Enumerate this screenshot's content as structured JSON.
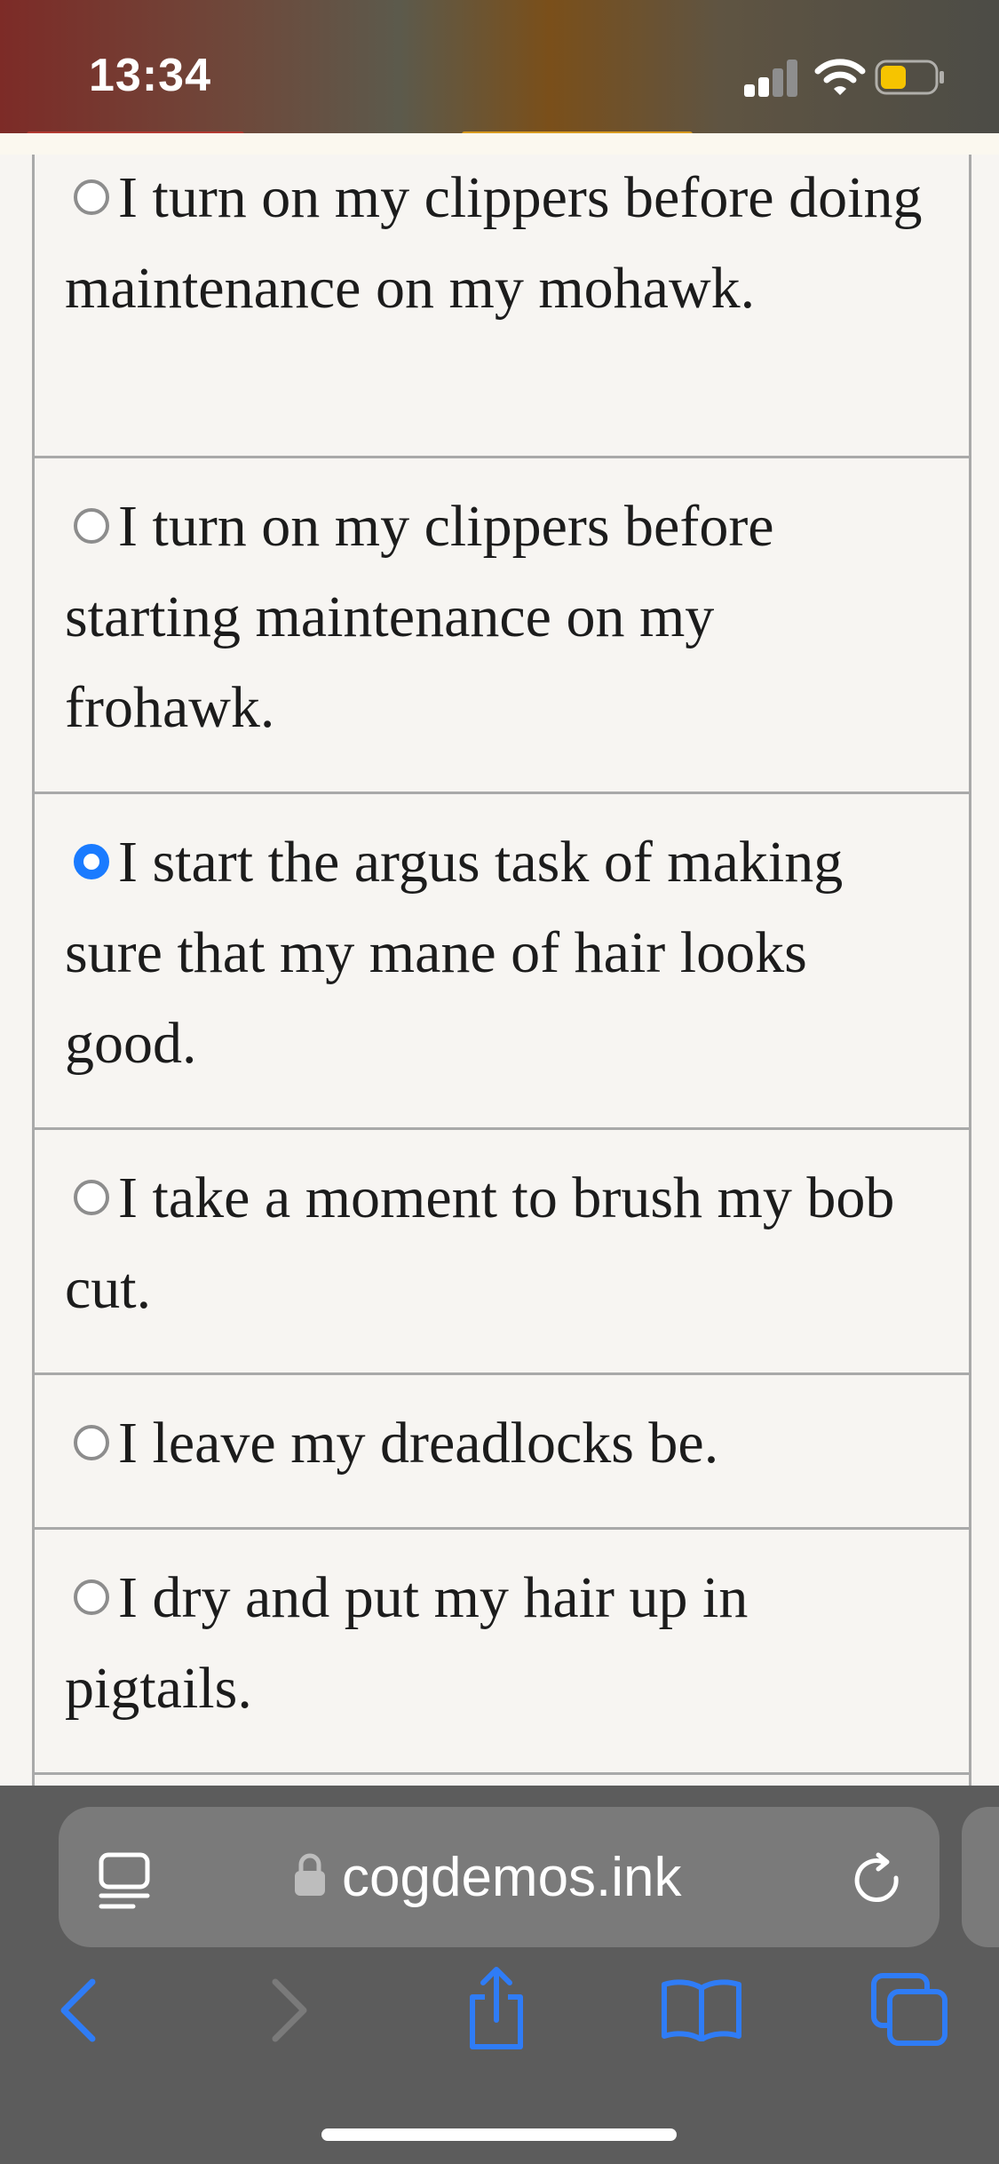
{
  "status_bar": {
    "time": "13:34",
    "icons": [
      "cellular-signal-icon",
      "wifi-icon",
      "battery-icon"
    ],
    "battery_color": "#f6c400"
  },
  "options": [
    {
      "text": "I turn on my clippers before doing maintenance on my mohawk.",
      "selected": false
    },
    {
      "text": "I turn on my clippers before starting maintenance on my frohawk.",
      "selected": false
    },
    {
      "text": "I start the argus task of making sure that my mane of hair looks good.",
      "selected": true
    },
    {
      "text": "I take a moment to brush my bob cut.",
      "selected": false
    },
    {
      "text": "I leave my dreadlocks be.",
      "selected": false
    },
    {
      "text": "I dry and put my hair up in pigtails.",
      "selected": false
    }
  ],
  "browser": {
    "url": "cogdemos.ink",
    "icons": [
      "reader-icon",
      "lock-icon",
      "reload-icon",
      "back-icon",
      "forward-icon",
      "share-icon",
      "bookmarks-icon",
      "tabs-icon"
    ],
    "accent_color": "#2f7cf6"
  }
}
